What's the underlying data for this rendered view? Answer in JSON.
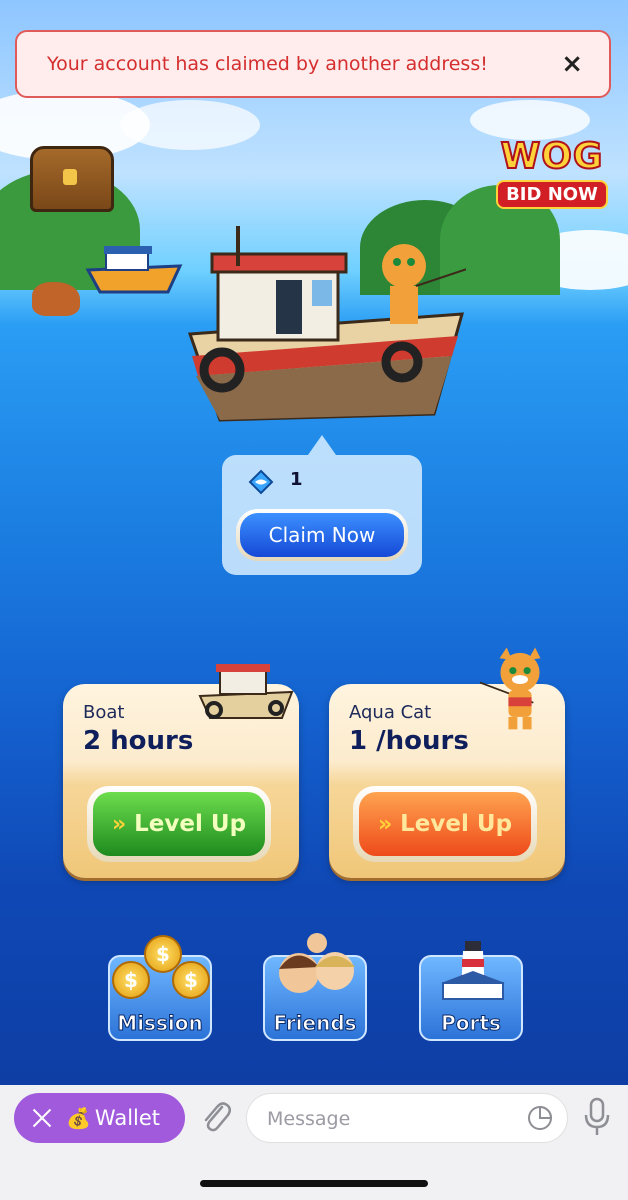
{
  "toast": {
    "message": "Your account has claimed by another address!",
    "close_symbol": "×"
  },
  "promo": {
    "title": "WOG",
    "subtitle": "BID NOW"
  },
  "claim_popup": {
    "token_count": "1",
    "button_label": "Claim Now"
  },
  "cards": [
    {
      "name": "Boat",
      "value": "2 hours",
      "button_label": "Level Up",
      "button_color": "#2fa62a"
    },
    {
      "name": "Aqua Cat",
      "value": "1 /hours",
      "button_label": "Level Up",
      "button_color": "#f06a28"
    }
  ],
  "level_up_icon": "»",
  "nav": [
    {
      "label": "Mission",
      "icon": "coins-icon"
    },
    {
      "label": "Friends",
      "icon": "friends-icon"
    },
    {
      "label": "Ports",
      "icon": "lighthouse-icon"
    }
  ],
  "telegram_bar": {
    "wallet_label": "Wallet",
    "wallet_emoji": "💰",
    "message_placeholder": "Message"
  },
  "colors": {
    "toast_text": "#d52e2e",
    "wallet_bg": "#a05adb",
    "ocean": "#1c7fe2"
  }
}
